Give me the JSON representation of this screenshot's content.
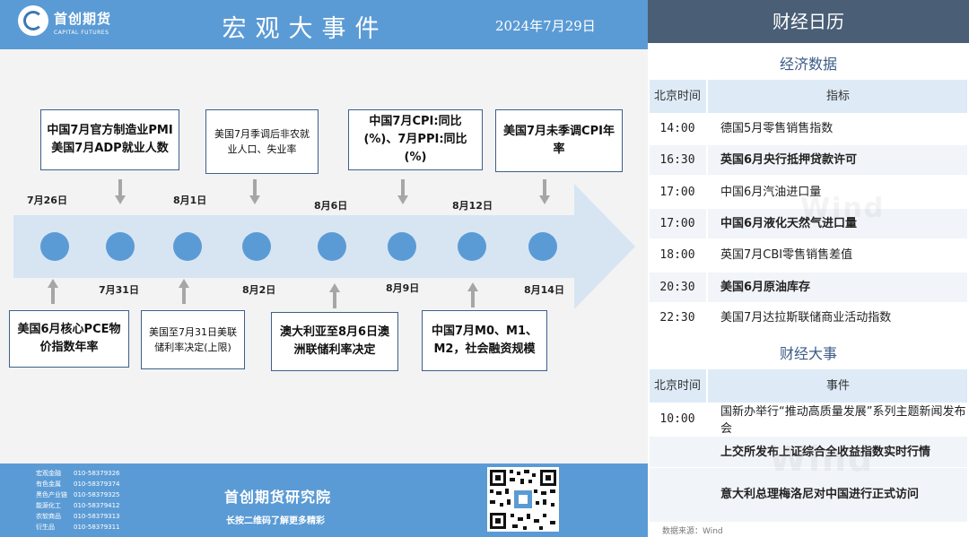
{
  "header": {
    "logo_cn": "首创期货",
    "logo_en": "CAPITAL FUTURES",
    "title": "宏观大事件",
    "date": "2024年7月29日"
  },
  "timeline": {
    "top_dates": [
      "7月26日",
      "8月1日",
      "8月6日",
      "8月12日"
    ],
    "bottom_dates": [
      "7月31日",
      "8月2日",
      "8月9日",
      "8月14日"
    ],
    "top_boxes": [
      "中国7月官方制造业PMI 美国7月ADP就业人数",
      "美国7月季调后非农就业人口、失业率",
      "中国7月CPI:同比(%)、7月PPI:同比(%)",
      "美国7月未季调CPI年率"
    ],
    "bottom_boxes": [
      "美国6月核心PCE物价指数年率",
      "美国至7月31日美联储利率决定(上限)",
      "澳大利亚至8月6日澳洲联储利率决定",
      "中国7月M0、M1、M2，社会融资规模"
    ]
  },
  "footer": {
    "contacts": [
      {
        "name": "宏观金融",
        "phone": "010-58379326"
      },
      {
        "name": "有色金属",
        "phone": "010-58379374"
      },
      {
        "name": "黑色产业链",
        "phone": "010-58379325"
      },
      {
        "name": "能源化工",
        "phone": "010-58379412"
      },
      {
        "name": "农软商品",
        "phone": "010-58379313"
      },
      {
        "name": "衍生品",
        "phone": "010-58379311"
      }
    ],
    "institute": "首创期货研究院",
    "qr_hint": "长按二维码了解更多精彩"
  },
  "calendar": {
    "title": "财经日历",
    "econ_title": "经济数据",
    "econ_header_time": "北京时间",
    "econ_header_col": "指标",
    "econ_rows": [
      {
        "time": "14:00",
        "name": "德国5月零售销售指数"
      },
      {
        "time": "16:30",
        "name": "英国6月央行抵押贷款许可"
      },
      {
        "time": "17:00",
        "name": "中国6月汽油进口量"
      },
      {
        "time": "17:00",
        "name": "中国6月液化天然气进口量"
      },
      {
        "time": "18:00",
        "name": "英国7月CBI零售销售差值"
      },
      {
        "time": "20:30",
        "name": "美国6月原油库存"
      },
      {
        "time": "22:30",
        "name": "美国7月达拉斯联储商业活动指数"
      }
    ],
    "events_title": "财经大事",
    "events_header_time": "北京时间",
    "events_header_col": "事件",
    "events": [
      {
        "time": "10:00",
        "text": "国新办举行“推动高质量发展”系列主题新闻发布会"
      },
      {
        "time": "",
        "text": "上交所发布上证综合全收益指数实时行情"
      },
      {
        "time": "",
        "text": "意大利总理梅洛尼对中国进行正式访问"
      }
    ],
    "watermark": "Wind",
    "source": "数据来源：Wind"
  }
}
